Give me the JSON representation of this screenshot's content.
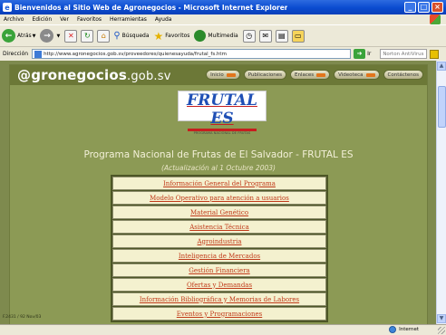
{
  "window": {
    "title": "Bienvenidos al Sitio Web de Agronegocios - Microsoft Internet Explorer"
  },
  "menubar": {
    "items": [
      "Archivo",
      "Edición",
      "Ver",
      "Favoritos",
      "Herramientas",
      "Ayuda"
    ]
  },
  "toolbar": {
    "back_label": "Atrás",
    "search_label": "Búsqueda",
    "favorites_label": "Favoritos",
    "media_label": "Multimedia"
  },
  "address": {
    "label": "Dirección",
    "url": "http://www.agronegocios.gob.sv/proveedores/quienesayuda/frutal_fs.htm",
    "go_label": "Ir",
    "norton_label": "Norton AntiVirus"
  },
  "site": {
    "logo_text": "@gronegocios",
    "logo_domain": ".gob.sv",
    "nav": [
      "Inicio",
      "Publicaciones",
      "Enlaces",
      "Videoteca",
      "Contáctenos"
    ],
    "frutal_logo": "FRUTAL ES",
    "frutal_tagline": "PROGRAMA NACIONAL DE FRUTAS",
    "program_title": "Programa Nacional de Frutas de El Salvador - FRUTAL ES",
    "program_subtitle": "(Actualización al 1 Octubre 2003)",
    "menu": [
      "Información General del Programa",
      "Modelo Operativo para atención a usuarios",
      "Material Genético",
      "Asistencia Técnica",
      "Agroindustria",
      "Inteligencia de Mercados",
      "Gestión Financiera",
      "Ofertas y Demandas",
      "Información Bibliográfica y Memorias de Labores",
      "Eventos y Programaciones"
    ]
  },
  "page_meta": "F.2431 / 92 Nov/03",
  "status": {
    "text": "",
    "zone": "Internet"
  }
}
